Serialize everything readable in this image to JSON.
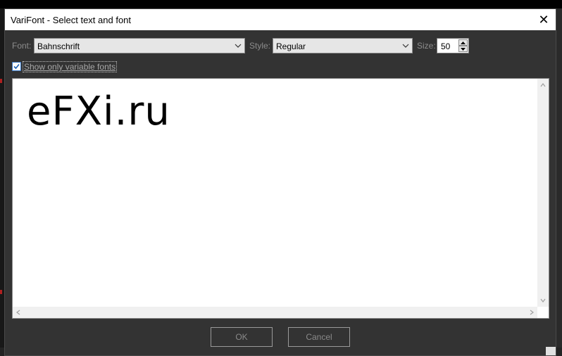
{
  "window": {
    "title": "VariFont - Select text and font",
    "close_glyph": "✕"
  },
  "font": {
    "label": "Font:",
    "value": "Bahnschrift"
  },
  "style": {
    "label": "Style:",
    "value": "Regular"
  },
  "size": {
    "label": "Size:",
    "value": "50"
  },
  "variable_only": {
    "label": "Show only variable fonts",
    "checked": true
  },
  "preview": {
    "text": "eFXi.ru"
  },
  "buttons": {
    "ok": "OK",
    "cancel": "Cancel"
  },
  "colors": {
    "accent": "#3a78c4",
    "dialog_bg": "#333333"
  }
}
